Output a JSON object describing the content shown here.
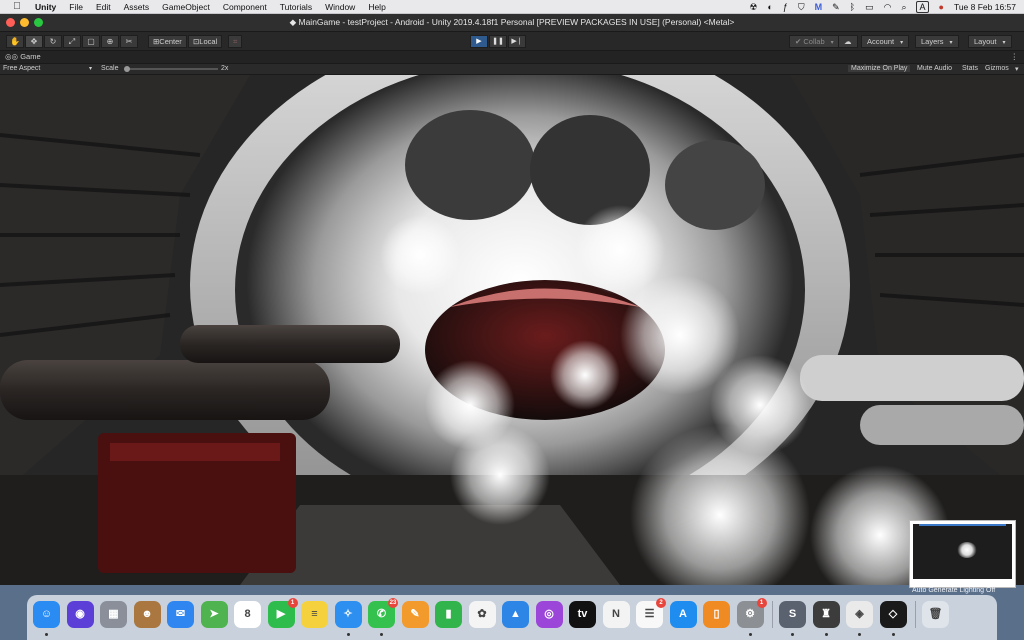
{
  "menubar": {
    "app_name": "Unity",
    "items": [
      "File",
      "Edit",
      "Assets",
      "GameObject",
      "Component",
      "Tutorials",
      "Window",
      "Help"
    ],
    "status_badge": "A",
    "clock": "Tue 8 Feb  16:57"
  },
  "window": {
    "title": "MainGame - testProject - Android - Unity 2019.4.18f1 Personal [PREVIEW PACKAGES IN USE] (Personal) <Metal>"
  },
  "toolbar": {
    "pivot_label": "Center",
    "space_label": "Local",
    "collab_label": "Collab",
    "account_label": "Account",
    "layers_label": "Layers",
    "layout_label": "Layout"
  },
  "game_view": {
    "tab_label": "Game",
    "aspect_label": "Free Aspect",
    "scale_label": "Scale",
    "scale_value": "2x",
    "scale_level": 0.0,
    "maximize_label": "Maximize On Play",
    "mute_label": "Mute Audio",
    "stats_label": "Stats",
    "gizmos_label": "Gizmos"
  },
  "thumbnail": {
    "caption": "Auto Generate Lighting Off"
  },
  "dock": {
    "apps": [
      {
        "icon": "finder-icon",
        "color": "#2a8bf2",
        "glyph": "☺",
        "running": true
      },
      {
        "icon": "siri-icon",
        "color": "#5b3fd6",
        "glyph": "◉",
        "running": false
      },
      {
        "icon": "launchpad-icon",
        "color": "#8a8f99",
        "glyph": "▦",
        "running": false
      },
      {
        "icon": "contacts-icon",
        "color": "#a9773f",
        "glyph": "☻",
        "running": false
      },
      {
        "icon": "mail-icon",
        "color": "#2f86f0",
        "glyph": "✉",
        "running": false
      },
      {
        "icon": "maps-icon",
        "color": "#4fb34f",
        "glyph": "➤",
        "running": false
      },
      {
        "icon": "calendar-icon",
        "color": "#ffffff",
        "glyph": "8",
        "running": false
      },
      {
        "icon": "facetime-icon",
        "color": "#2ebd4d",
        "glyph": "▶",
        "running": false,
        "badge": "1"
      },
      {
        "icon": "notes-icon",
        "color": "#f5d23d",
        "glyph": "≡",
        "running": false
      },
      {
        "icon": "safari-icon",
        "color": "#2d8ff0",
        "glyph": "✧",
        "running": true
      },
      {
        "icon": "messages-icon",
        "color": "#34c14e",
        "glyph": "✆",
        "running": true,
        "badge": "23"
      },
      {
        "icon": "pages-icon",
        "color": "#f29a2b",
        "glyph": "✎",
        "running": false
      },
      {
        "icon": "numbers-icon",
        "color": "#31b44b",
        "glyph": "▮",
        "running": false
      },
      {
        "icon": "photos-icon",
        "color": "#f4f4f4",
        "glyph": "✿",
        "running": false
      },
      {
        "icon": "keynote-icon",
        "color": "#2d86e6",
        "glyph": "▲",
        "running": false
      },
      {
        "icon": "podcasts-icon",
        "color": "#9b46d8",
        "glyph": "◎",
        "running": false
      },
      {
        "icon": "tv-icon",
        "color": "#111111",
        "glyph": "tv",
        "running": false
      },
      {
        "icon": "news-icon",
        "color": "#f3f3f3",
        "glyph": "N",
        "running": false
      },
      {
        "icon": "reminders-icon",
        "color": "#f8f8f8",
        "glyph": "☰",
        "running": false,
        "badge": "2"
      },
      {
        "icon": "app-store-icon",
        "color": "#1f8cf0",
        "glyph": "A",
        "running": false
      },
      {
        "icon": "books-icon",
        "color": "#f08a22",
        "glyph": "▯",
        "running": false
      },
      {
        "icon": "system-preferences-icon",
        "color": "#8c8f94",
        "glyph": "⚙",
        "running": true,
        "badge": "1"
      }
    ],
    "apps_right": [
      {
        "icon": "sublime-icon",
        "color": "#5a6270",
        "glyph": "S",
        "running": true
      },
      {
        "icon": "unity-hub-icon",
        "color": "#3c3c3c",
        "glyph": "♜",
        "running": true
      },
      {
        "icon": "unity-cube-icon",
        "color": "#eaeaea",
        "glyph": "◈",
        "running": true
      },
      {
        "icon": "unity-editor-icon",
        "color": "#1a1a1a",
        "glyph": "◇",
        "running": true
      }
    ],
    "trash": {
      "icon": "trash-icon",
      "color": "#dfe3ea",
      "glyph": "🗑"
    }
  }
}
